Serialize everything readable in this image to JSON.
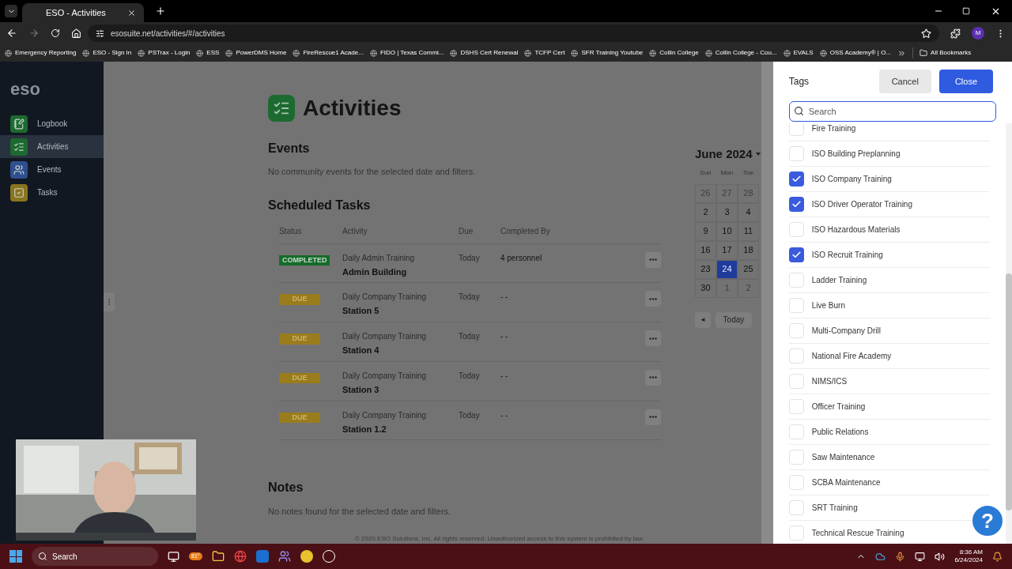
{
  "browser": {
    "tabs": [
      {
        "title": "ESO - Activities",
        "selected": true
      }
    ],
    "url": "esosuite.net/activities/#/activities",
    "profile": "M",
    "bookmarks": [
      "Emergency Reporting",
      "ESO - Sign In",
      "PSTrax - Login",
      "ESS",
      "PowerDMS Home",
      "FireRescue1 Acade...",
      "FIDO | Texas Commi...",
      "DSHS Cert Renewal",
      "TCFP Cert",
      "SFR Training Youtube",
      "Collin College",
      "Collin College - Cou...",
      "EVALS",
      "OSS Academy® | O..."
    ],
    "all_bookmarks": "All Bookmarks"
  },
  "sidebar": {
    "logo": "eso",
    "items": [
      {
        "label": "Logbook",
        "kind": "notebook",
        "selected": false
      },
      {
        "label": "Activities",
        "kind": "checklist",
        "selected": true
      },
      {
        "label": "Events",
        "kind": "people",
        "selected": false
      },
      {
        "label": "Tasks",
        "kind": "check",
        "selected": false
      }
    ]
  },
  "page": {
    "title": "Activities",
    "events": {
      "heading": "Events",
      "empty": "No community events for the selected date and filters."
    },
    "scheduled_tasks": {
      "heading": "Scheduled Tasks",
      "columns": [
        "Status",
        "Activity",
        "Due",
        "Completed By"
      ],
      "rows": [
        {
          "status": "COMPLETED",
          "kind": "completed",
          "activity": "Daily Admin Training",
          "location": "Admin Building",
          "due": "Today",
          "completed_by": "4 personnel"
        },
        {
          "status": "DUE",
          "kind": "due",
          "activity": "Daily Company Training",
          "location": "Station 5",
          "due": "Today",
          "completed_by": "- -"
        },
        {
          "status": "DUE",
          "kind": "due",
          "activity": "Daily Company Training",
          "location": "Station 4",
          "due": "Today",
          "completed_by": "- -"
        },
        {
          "status": "DUE",
          "kind": "due",
          "activity": "Daily Company Training",
          "location": "Station 3",
          "due": "Today",
          "completed_by": "- -"
        },
        {
          "status": "DUE",
          "kind": "due",
          "activity": "Daily Company Training",
          "location": "Station 1.2",
          "due": "Today",
          "completed_by": "- -"
        }
      ]
    },
    "notes": {
      "heading": "Notes",
      "empty": "No notes found for the selected date and filters."
    },
    "footer": "© 2020 ESO Solutions, Inc. All rights reserved. Unauthorized access to this system is prohibited by law."
  },
  "calendar": {
    "month": "June 2024",
    "weekdays": [
      "Sun",
      "Mon",
      "Tue"
    ],
    "weeks": [
      [
        {
          "day": "26",
          "other_month": true,
          "selected": false
        },
        {
          "day": "27",
          "other_month": true,
          "selected": false
        },
        {
          "day": "28",
          "other_month": true,
          "selected": false
        }
      ],
      [
        {
          "day": "2",
          "other_month": false,
          "selected": false
        },
        {
          "day": "3",
          "other_month": false,
          "selected": false
        },
        {
          "day": "4",
          "other_month": false,
          "selected": false
        }
      ],
      [
        {
          "day": "9",
          "other_month": false,
          "selected": false
        },
        {
          "day": "10",
          "other_month": false,
          "selected": false
        },
        {
          "day": "11",
          "other_month": false,
          "selected": false
        }
      ],
      [
        {
          "day": "16",
          "other_month": false,
          "selected": false
        },
        {
          "day": "17",
          "other_month": false,
          "selected": false
        },
        {
          "day": "18",
          "other_month": false,
          "selected": false
        }
      ],
      [
        {
          "day": "23",
          "other_month": false,
          "selected": false
        },
        {
          "day": "24",
          "other_month": false,
          "selected": true
        },
        {
          "day": "25",
          "other_month": false,
          "selected": false
        }
      ],
      [
        {
          "day": "30",
          "other_month": false,
          "selected": false
        },
        {
          "day": "1",
          "other_month": true,
          "selected": false
        },
        {
          "day": "2",
          "other_month": true,
          "selected": false
        }
      ]
    ],
    "prev": "◄",
    "today": "Today"
  },
  "tags_panel": {
    "title": "Tags",
    "cancel": "Cancel",
    "close": "Close",
    "search": {
      "placeholder": "Search"
    },
    "items": [
      {
        "label": "Fire Training",
        "checked": false
      },
      {
        "label": "ISO Building Preplanning",
        "checked": false
      },
      {
        "label": "ISO Company Training",
        "checked": true
      },
      {
        "label": "ISO Driver Operator Training",
        "checked": true
      },
      {
        "label": "ISO Hazardous Materials",
        "checked": false
      },
      {
        "label": "ISO Recruit Training",
        "checked": true
      },
      {
        "label": "Ladder Training",
        "checked": false
      },
      {
        "label": "Live Burn",
        "checked": false
      },
      {
        "label": "Multi-Company Drill",
        "checked": false
      },
      {
        "label": "National Fire Academy",
        "checked": false
      },
      {
        "label": "NIMS/ICS",
        "checked": false
      },
      {
        "label": "Officer Training",
        "checked": false
      },
      {
        "label": "Public Relations",
        "checked": false
      },
      {
        "label": "Saw Maintenance",
        "checked": false
      },
      {
        "label": "SCBA Maintenance",
        "checked": false
      },
      {
        "label": "SRT Training",
        "checked": false
      },
      {
        "label": "Technical Rescue Training",
        "checked": false
      }
    ],
    "help": "?"
  },
  "taskbar": {
    "search": "Search",
    "weather": "81°",
    "time": "8:36 AM",
    "date": "6/24/2024"
  }
}
